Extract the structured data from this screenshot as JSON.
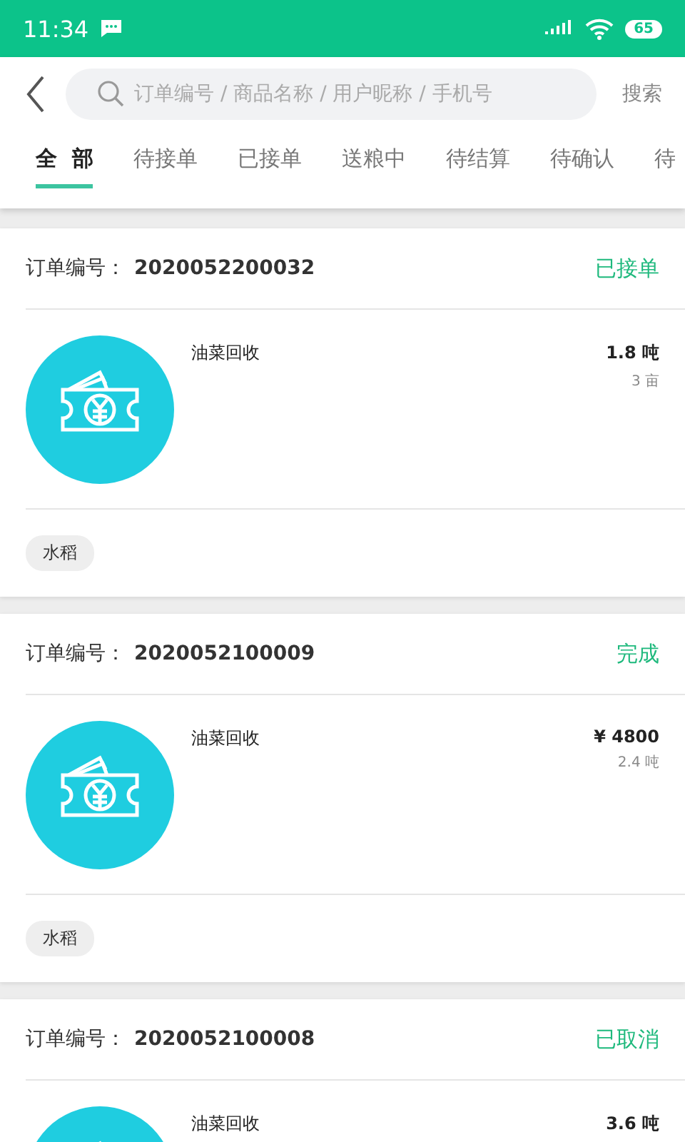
{
  "status_bar": {
    "time": "11:34",
    "battery": "65"
  },
  "search": {
    "placeholder": "订单编号 / 商品名称 / 用户昵称 / 手机号",
    "button": "搜索"
  },
  "tabs": [
    {
      "label": "全  部",
      "selected": true
    },
    {
      "label": "待接单",
      "selected": false
    },
    {
      "label": "已接单",
      "selected": false
    },
    {
      "label": "送粮中",
      "selected": false
    },
    {
      "label": "待结算",
      "selected": false
    },
    {
      "label": "待确认",
      "selected": false
    },
    {
      "label": "待",
      "selected": false
    }
  ],
  "orders": [
    {
      "number_label": "订单编号：",
      "number": "2020052200032",
      "status": "已接单",
      "product": "油菜回收",
      "amount": "1.8 吨",
      "detail": "3 亩",
      "tag": "水稻"
    },
    {
      "number_label": "订单编号：",
      "number": "2020052100009",
      "status": "完成",
      "product": "油菜回收",
      "amount": "¥ 4800",
      "detail": "2.4 吨",
      "tag": "水稻"
    },
    {
      "number_label": "订单编号：",
      "number": "2020052100008",
      "status": "已取消",
      "product": "油菜回收",
      "amount": "3.6 吨"
    }
  ]
}
